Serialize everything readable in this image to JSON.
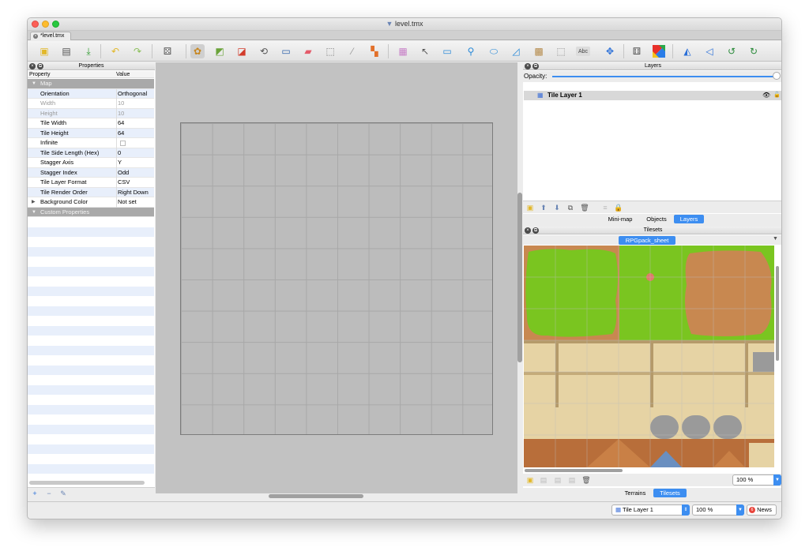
{
  "window": {
    "title": "level.tmx",
    "doc_tab": "*level.tmx"
  },
  "properties": {
    "title": "Properties",
    "col_property": "Property",
    "col_value": "Value",
    "group_map": "Map",
    "group_custom": "Custom Properties",
    "rows": [
      {
        "key": "Orientation",
        "value": "Orthogonal"
      },
      {
        "key": "Width",
        "value": "10"
      },
      {
        "key": "Height",
        "value": "10"
      },
      {
        "key": "Tile Width",
        "value": "64"
      },
      {
        "key": "Tile Height",
        "value": "64"
      },
      {
        "key": "Infinite",
        "value": ""
      },
      {
        "key": "Tile Side Length (Hex)",
        "value": "0"
      },
      {
        "key": "Stagger Axis",
        "value": "Y"
      },
      {
        "key": "Stagger Index",
        "value": "Odd"
      },
      {
        "key": "Tile Layer Format",
        "value": "CSV"
      },
      {
        "key": "Tile Render Order",
        "value": "Right Down"
      },
      {
        "key": "Background Color",
        "value": "Not set"
      }
    ]
  },
  "layers": {
    "title": "Layers",
    "opacity_label": "Opacity:",
    "opacity": 1.0,
    "items": [
      {
        "name": "Tile Layer 1"
      }
    ],
    "tabs": [
      "Mini-map",
      "Objects",
      "Layers"
    ],
    "selected_tab": "Layers"
  },
  "tilesets": {
    "title": "Tilesets",
    "sheet_name": "RPGpack_sheet",
    "zoom": "100 %",
    "tabs": [
      "Terrains",
      "Tilesets"
    ],
    "selected_tab": "Tilesets"
  },
  "status": {
    "layer_combo": "Tile Layer 1",
    "zoom_combo": "100 %",
    "news_label": "News"
  },
  "colors": {
    "accent": "#3d8ef1",
    "grass": "#7ac520",
    "dirt": "#c88850"
  }
}
